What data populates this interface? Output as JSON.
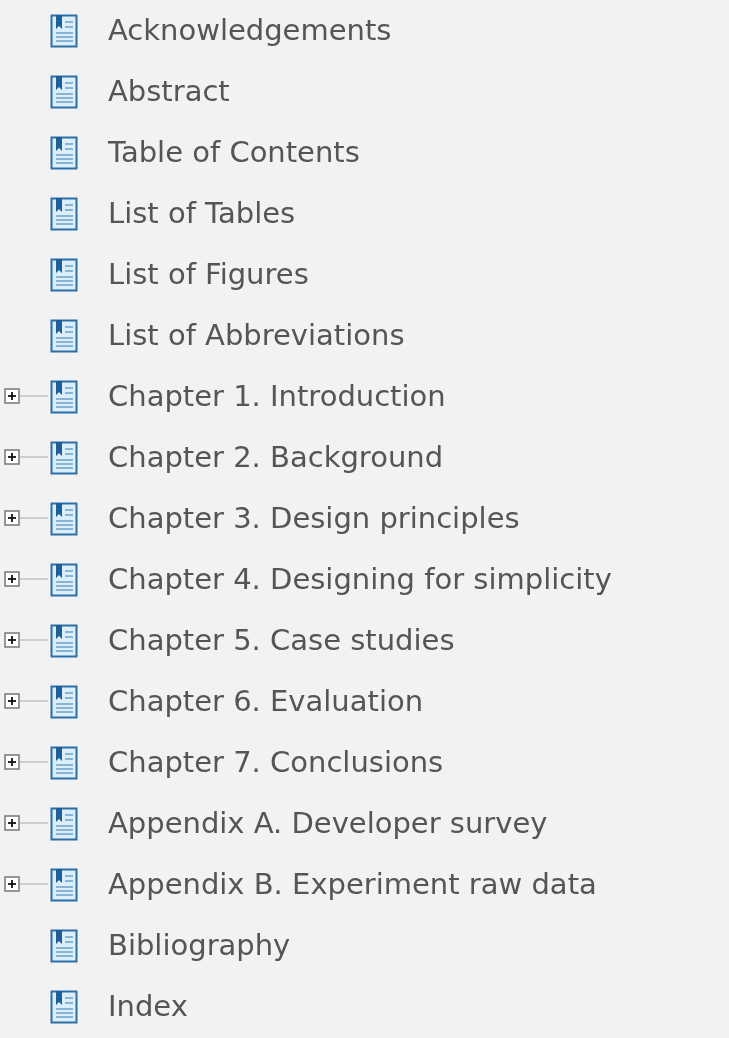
{
  "bookmarks": [
    {
      "label": "Acknowledgements",
      "kind": "leaf"
    },
    {
      "label": "Abstract",
      "kind": "leaf"
    },
    {
      "label": "Table of Contents",
      "kind": "leaf"
    },
    {
      "label": "List of Tables",
      "kind": "leaf"
    },
    {
      "label": "List of Figures",
      "kind": "leaf"
    },
    {
      "label": "List of Abbreviations",
      "kind": "leaf"
    },
    {
      "label": "Chapter 1. Introduction",
      "kind": "node",
      "expanded": false
    },
    {
      "label": "Chapter 2. Background",
      "kind": "node",
      "expanded": false
    },
    {
      "label": "Chapter 3. Design principles",
      "kind": "node",
      "expanded": false
    },
    {
      "label": "Chapter 4. Designing for simplicity",
      "kind": "node",
      "expanded": false
    },
    {
      "label": "Chapter 5. Case studies",
      "kind": "node",
      "expanded": false
    },
    {
      "label": "Chapter 6. Evaluation",
      "kind": "node",
      "expanded": false
    },
    {
      "label": "Chapter 7. Conclusions",
      "kind": "node",
      "expanded": false
    },
    {
      "label": "Appendix A. Developer survey",
      "kind": "node",
      "expanded": false
    },
    {
      "label": "Appendix B. Experiment raw data",
      "kind": "node",
      "expanded": false
    },
    {
      "label": "Bibliography",
      "kind": "leaf"
    },
    {
      "label": "Index",
      "kind": "leaf"
    }
  ]
}
